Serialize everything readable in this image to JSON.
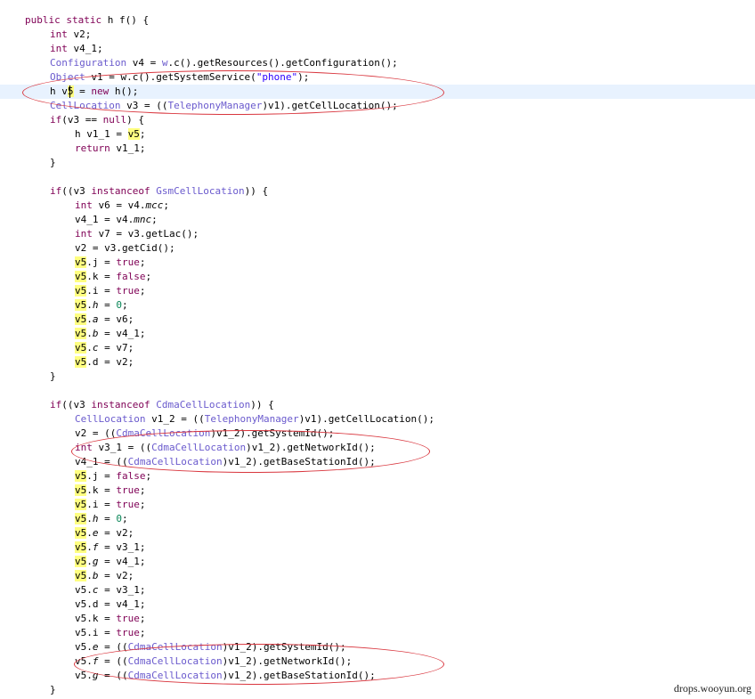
{
  "code": {
    "lines": [
      [
        [
          "public static ",
          "kw"
        ],
        [
          "h f() {",
          ""
        ]
      ],
      [
        [
          "int ",
          "kw"
        ],
        [
          "v2;",
          ""
        ]
      ],
      [
        [
          "int ",
          "kw"
        ],
        [
          "v4_1;",
          ""
        ]
      ],
      [
        [
          "Configuration",
          "ty"
        ],
        [
          " v4 = ",
          ""
        ],
        [
          "w",
          "ty"
        ],
        [
          ".c().getResources().getConfiguration();",
          ""
        ]
      ],
      [
        [
          "Object",
          "ty"
        ],
        [
          " v1 = w.c().getSystemService(",
          ""
        ],
        [
          "\"phone\"",
          "st"
        ],
        [
          ");",
          ""
        ]
      ],
      [
        [
          "h v",
          ""
        ],
        [
          "5",
          "hl"
        ],
        [
          " = ",
          ""
        ],
        [
          "new ",
          "kw"
        ],
        [
          "h();",
          ""
        ]
      ],
      [
        [
          "CellLocation",
          "ty"
        ],
        [
          " v3 = ((",
          ""
        ],
        [
          "TelephonyManager",
          "ty"
        ],
        [
          ")v1).getCellLocation();",
          ""
        ]
      ],
      [
        [
          "if",
          "kw"
        ],
        [
          "(v3 == ",
          ""
        ],
        [
          "null",
          "kw"
        ],
        [
          ") {",
          ""
        ]
      ],
      [
        [
          "h v1_1 = ",
          ""
        ],
        [
          "v5",
          "hl"
        ],
        [
          ";",
          ""
        ]
      ],
      [
        [
          "return ",
          "kw"
        ],
        [
          "v1_1;",
          ""
        ]
      ],
      [
        [
          "}",
          ""
        ]
      ],
      [],
      [
        [
          "if",
          "kw"
        ],
        [
          "((v3 ",
          ""
        ],
        [
          "instanceof ",
          "kw"
        ],
        [
          "GsmCellLocation",
          "ty"
        ],
        [
          ")) {",
          ""
        ]
      ],
      [
        [
          "int ",
          "kw"
        ],
        [
          "v6 = v4.",
          ""
        ],
        [
          "mcc",
          "it"
        ],
        [
          ";",
          ""
        ]
      ],
      [
        [
          "v4_1 = v4.",
          ""
        ],
        [
          "mnc",
          "it"
        ],
        [
          ";",
          ""
        ]
      ],
      [
        [
          "int ",
          "kw"
        ],
        [
          "v7 = v3.getLac();",
          ""
        ]
      ],
      [
        [
          "v2 = v3.getCid();",
          ""
        ]
      ],
      [
        [
          "v5",
          "hl"
        ],
        [
          ".j = ",
          ""
        ],
        [
          "true",
          "kw"
        ],
        [
          ";",
          ""
        ]
      ],
      [
        [
          "v5",
          "hl"
        ],
        [
          ".k = ",
          ""
        ],
        [
          "false",
          "kw"
        ],
        [
          ";",
          ""
        ]
      ],
      [
        [
          "v5",
          "hl"
        ],
        [
          ".i = ",
          ""
        ],
        [
          "true",
          "kw"
        ],
        [
          ";",
          ""
        ]
      ],
      [
        [
          "v5",
          "hl"
        ],
        [
          ".",
          ""
        ],
        [
          "h",
          "it"
        ],
        [
          " = ",
          ""
        ],
        [
          "0",
          "nm"
        ],
        [
          ";",
          ""
        ]
      ],
      [
        [
          "v5",
          "hl"
        ],
        [
          ".",
          ""
        ],
        [
          "a",
          "it"
        ],
        [
          " = v6;",
          ""
        ]
      ],
      [
        [
          "v5",
          "hl"
        ],
        [
          ".",
          ""
        ],
        [
          "b",
          "it"
        ],
        [
          " = v4_1;",
          ""
        ]
      ],
      [
        [
          "v5",
          "hl"
        ],
        [
          ".",
          ""
        ],
        [
          "c",
          "it"
        ],
        [
          " = v7;",
          ""
        ]
      ],
      [
        [
          "v5",
          "hl"
        ],
        [
          ".d = v2;",
          ""
        ]
      ],
      [
        [
          "}",
          ""
        ]
      ],
      [],
      [
        [
          "if",
          "kw"
        ],
        [
          "((v3 ",
          ""
        ],
        [
          "instanceof ",
          "kw"
        ],
        [
          "CdmaCellLocation",
          "ty"
        ],
        [
          ")) {",
          ""
        ]
      ],
      [
        [
          "CellLocation",
          "ty"
        ],
        [
          " v1_2 = ((",
          ""
        ],
        [
          "TelephonyManager",
          "ty"
        ],
        [
          ")v1).getCellLocation();",
          ""
        ]
      ],
      [
        [
          "v2 = ((",
          ""
        ],
        [
          "CdmaCellLocation",
          "ty"
        ],
        [
          ")v1_2).getSystemId();",
          ""
        ]
      ],
      [
        [
          "int ",
          "kw"
        ],
        [
          "v3_1 = ((",
          ""
        ],
        [
          "CdmaCellLocation",
          "ty"
        ],
        [
          ")v1_2).getNetworkId();",
          ""
        ]
      ],
      [
        [
          "v4_1 = ((",
          ""
        ],
        [
          "CdmaCellLocation",
          "ty"
        ],
        [
          ")v1_2).getBaseStationId();",
          ""
        ]
      ],
      [
        [
          "v5",
          "hl"
        ],
        [
          ".j = ",
          ""
        ],
        [
          "false",
          "kw"
        ],
        [
          ";",
          ""
        ]
      ],
      [
        [
          "v5",
          "hl"
        ],
        [
          ".k = ",
          ""
        ],
        [
          "true",
          "kw"
        ],
        [
          ";",
          ""
        ]
      ],
      [
        [
          "v5",
          "hl"
        ],
        [
          ".i = ",
          ""
        ],
        [
          "true",
          "kw"
        ],
        [
          ";",
          ""
        ]
      ],
      [
        [
          "v5",
          "hl"
        ],
        [
          ".",
          ""
        ],
        [
          "h",
          "it"
        ],
        [
          " = ",
          ""
        ],
        [
          "0",
          "nm"
        ],
        [
          ";",
          ""
        ]
      ],
      [
        [
          "v5",
          "hl"
        ],
        [
          ".",
          ""
        ],
        [
          "e",
          "it"
        ],
        [
          " = v2;",
          ""
        ]
      ],
      [
        [
          "v5",
          "hl"
        ],
        [
          ".",
          ""
        ],
        [
          "f",
          "it"
        ],
        [
          " = v3_1;",
          ""
        ]
      ],
      [
        [
          "v5",
          "hl"
        ],
        [
          ".",
          ""
        ],
        [
          "g",
          "it"
        ],
        [
          " = v4_1;",
          ""
        ]
      ],
      [
        [
          "v5",
          "hl"
        ],
        [
          ".",
          ""
        ],
        [
          "b",
          "it"
        ],
        [
          " = v2;",
          ""
        ]
      ],
      [
        [
          "v5.",
          ""
        ],
        [
          "c",
          "it"
        ],
        [
          " = v3_1;",
          ""
        ]
      ],
      [
        [
          "v5.d = v4_1;",
          ""
        ]
      ],
      [
        [
          "v5.k = ",
          ""
        ],
        [
          "true",
          "kw"
        ],
        [
          ";",
          ""
        ]
      ],
      [
        [
          "v5.i = ",
          ""
        ],
        [
          "true",
          "kw"
        ],
        [
          ";",
          ""
        ]
      ],
      [
        [
          "v5.",
          ""
        ],
        [
          "e",
          "it"
        ],
        [
          " = ((",
          ""
        ],
        [
          "CdmaCellLocation",
          "ty"
        ],
        [
          ")v1_2).getSystemId();",
          ""
        ]
      ],
      [
        [
          "v5.",
          ""
        ],
        [
          "f",
          "it"
        ],
        [
          " = ((",
          ""
        ],
        [
          "CdmaCellLocation",
          "ty"
        ],
        [
          ")v1_2).getNetworkId();",
          ""
        ]
      ],
      [
        [
          "v5.",
          ""
        ],
        [
          "g",
          "it"
        ],
        [
          " = ((",
          ""
        ],
        [
          "CdmaCellLocation",
          "ty"
        ],
        [
          ")v1_2).getBaseStationId();",
          ""
        ]
      ],
      [
        [
          "}",
          ""
        ]
      ]
    ]
  },
  "watermark": "drops.wooyun.org"
}
